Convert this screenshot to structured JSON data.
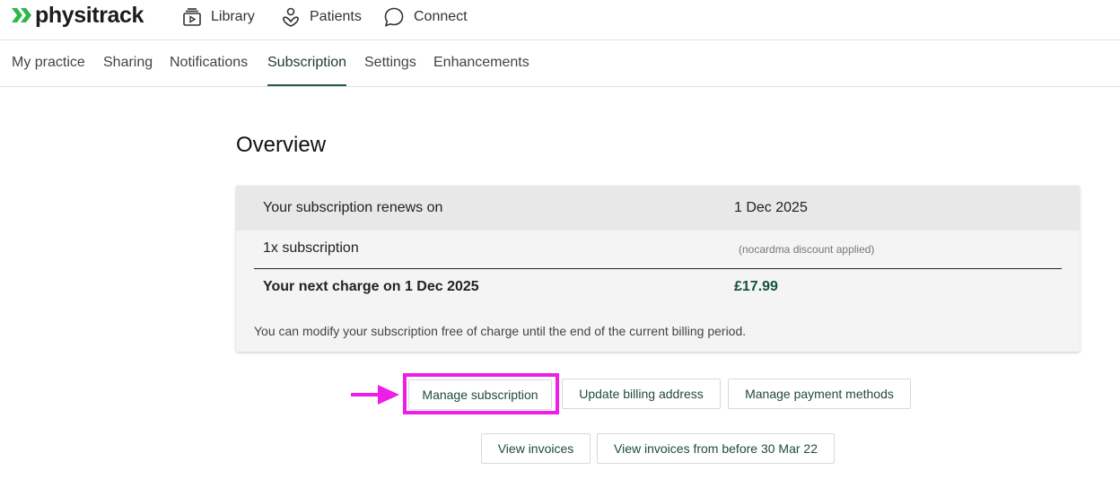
{
  "header": {
    "logo_text": "physitrack",
    "nav": [
      {
        "label": "Library",
        "icon": "library-icon"
      },
      {
        "label": "Patients",
        "icon": "patients-icon"
      },
      {
        "label": "Connect",
        "icon": "chat-bubble-icon"
      }
    ]
  },
  "tabs": [
    {
      "label": "My practice"
    },
    {
      "label": "Sharing"
    },
    {
      "label": "Notifications"
    },
    {
      "label": "Subscription",
      "active": true
    },
    {
      "label": "Settings"
    },
    {
      "label": "Enhancements"
    }
  ],
  "overview": {
    "title": "Overview",
    "renews_label": "Your subscription renews on",
    "renews_date": "1 Dec 2025",
    "plan_label": "1x subscription",
    "discount_note": "(nocardma discount applied)",
    "next_charge_label": "Your next charge on 1 Dec 2025",
    "next_charge_amount": "£17.99",
    "info_text": "You can modify your subscription free of charge until the end of the current billing period."
  },
  "buttons": {
    "manage_subscription": "Manage subscription",
    "update_billing_address": "Update billing address",
    "manage_payment_methods": "Manage payment methods",
    "view_invoices": "View invoices",
    "view_invoices_before": "View invoices from before 30 Mar 22"
  },
  "colors": {
    "brand_green": "#2db84b",
    "accent_dark_green": "#1f5a4a",
    "highlight_magenta": "#ef1de6"
  }
}
